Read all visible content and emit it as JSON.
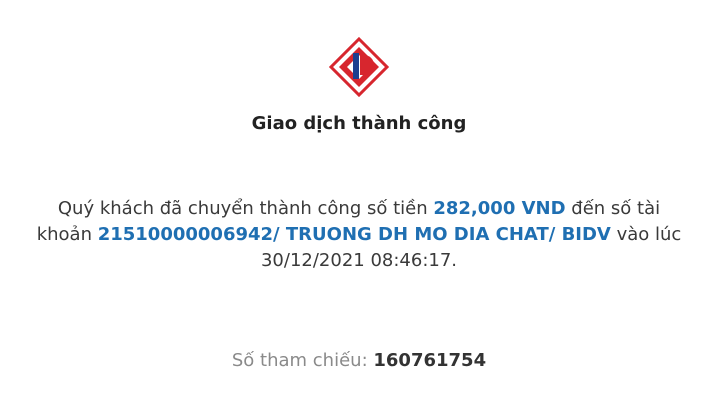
{
  "logo": {
    "icon": "bidv-logo-icon",
    "colors": {
      "red": "#d7262e",
      "navy": "#1d3f8f"
    }
  },
  "title": "Giao dịch thành công",
  "message": {
    "part1": "Quý khách đã chuyển thành công số tiền ",
    "amount": "282,000 VND",
    "part2": " đến số tài khoản ",
    "account": "21510000006942/ TRUONG DH MO DIA CHAT/ BIDV",
    "part3": " vào lúc 30/12/2021 08:46:17."
  },
  "reference": {
    "label": "Số tham chiếu: ",
    "value": "160761754"
  },
  "colors": {
    "accent": "#1f6fb2",
    "muted": "#8a8a8a"
  }
}
